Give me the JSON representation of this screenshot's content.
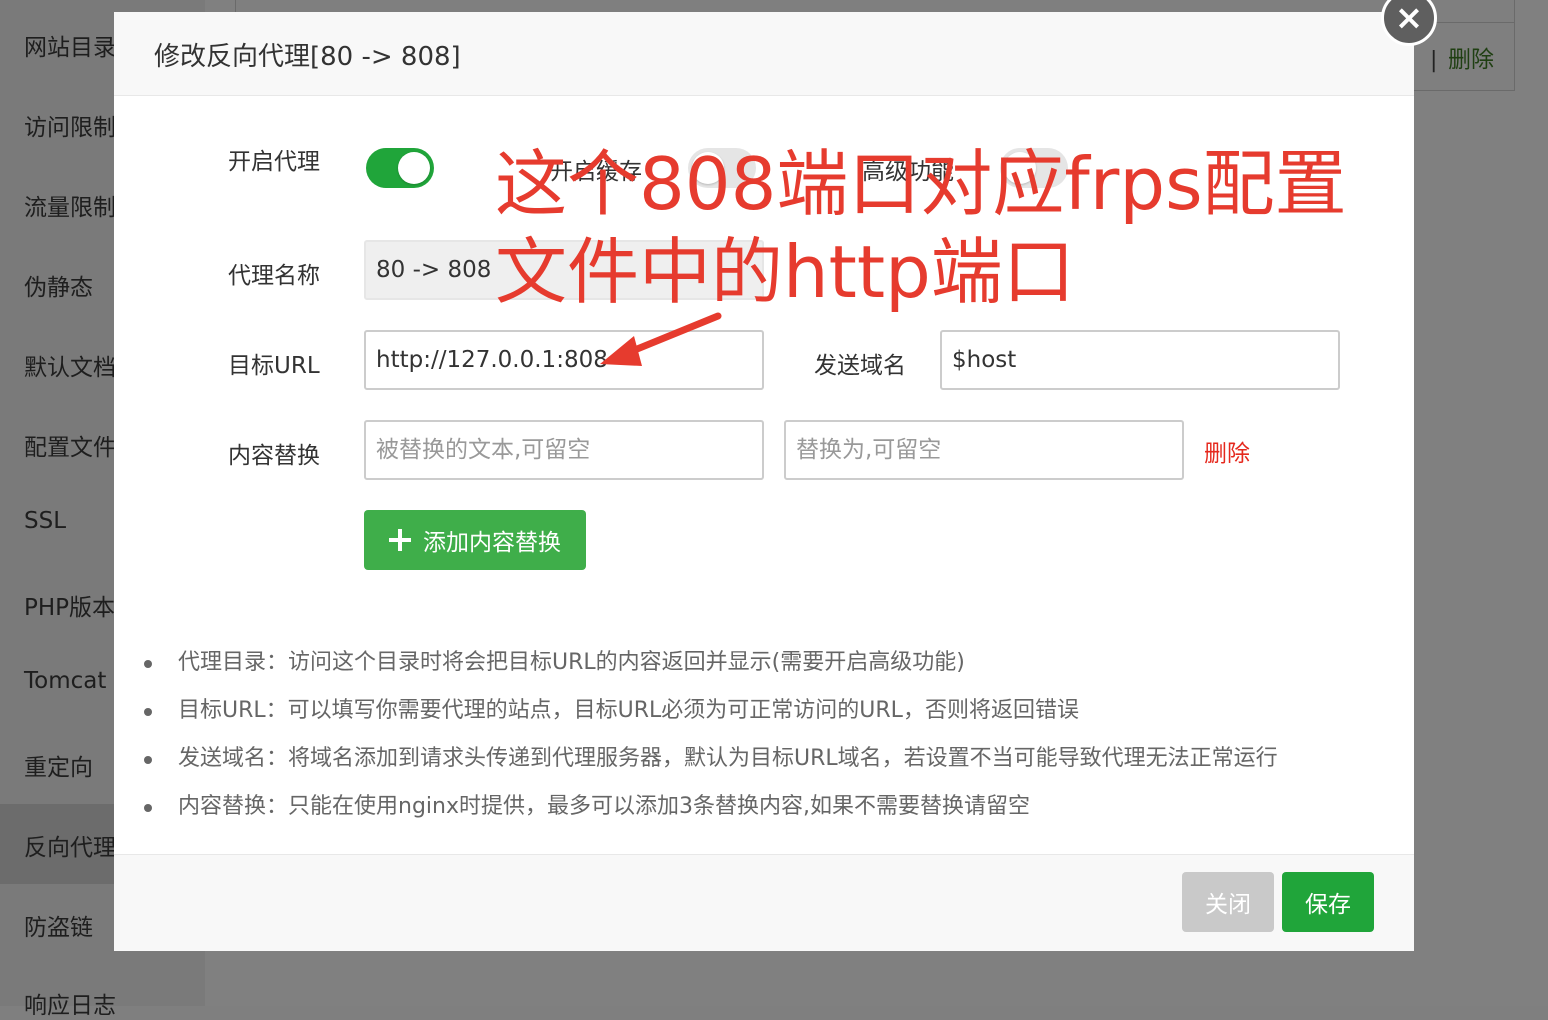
{
  "background": {
    "sidebar_items": [
      "网站目录",
      "访问限制",
      "流量限制",
      "伪静态",
      "默认文档",
      "配置文件",
      "SSL",
      "PHP版本",
      "Tomcat",
      "重定向",
      "反向代理",
      "防盗链",
      "响应日志"
    ],
    "table_separator": "|",
    "table_delete_link": "删除"
  },
  "modal": {
    "title": "修改反向代理[80 -> 808]",
    "close_icon": "×",
    "enable_proxy_label": "开启代理",
    "enable_proxy": true,
    "enable_cache_label": "开启缓存",
    "enable_cache": false,
    "advanced_label": "高级功能",
    "advanced": false,
    "proxy_name_label": "代理名称",
    "proxy_name_value": "80 -> 808",
    "target_url_label": "目标URL",
    "target_url_value": "http://127.0.0.1:808",
    "send_domain_label": "发送域名",
    "send_domain_value": "$host",
    "content_replace_label": "内容替换",
    "replace_from_placeholder": "被替换的文本,可留空",
    "replace_to_placeholder": "替换为,可留空",
    "delete_label": "删除",
    "add_replace_button": "添加内容替换",
    "add_icon": "plus-icon",
    "tips": [
      "代理目录：访问这个目录时将会把目标URL的内容返回并显示(需要开启高级功能)",
      "目标URL：可以填写你需要代理的站点，目标URL必须为可正常访问的URL，否则将返回错误",
      "发送域名：将域名添加到请求头传递到代理服务器，默认为目标URL域名，若设置不当可能导致代理无法正常运行",
      "内容替换：只能在使用nginx时提供，最多可以添加3条替换内容,如果不需要替换请留空"
    ],
    "close_button": "关闭",
    "save_button": "保存"
  },
  "annotation": {
    "line1": "这个808端口对应frps配置",
    "line2": "文件中的http端口",
    "color": "#e63b2e"
  },
  "colors": {
    "accent_green": "#20a53a",
    "button_green": "#3fae4a",
    "danger_red": "#e5281d"
  }
}
